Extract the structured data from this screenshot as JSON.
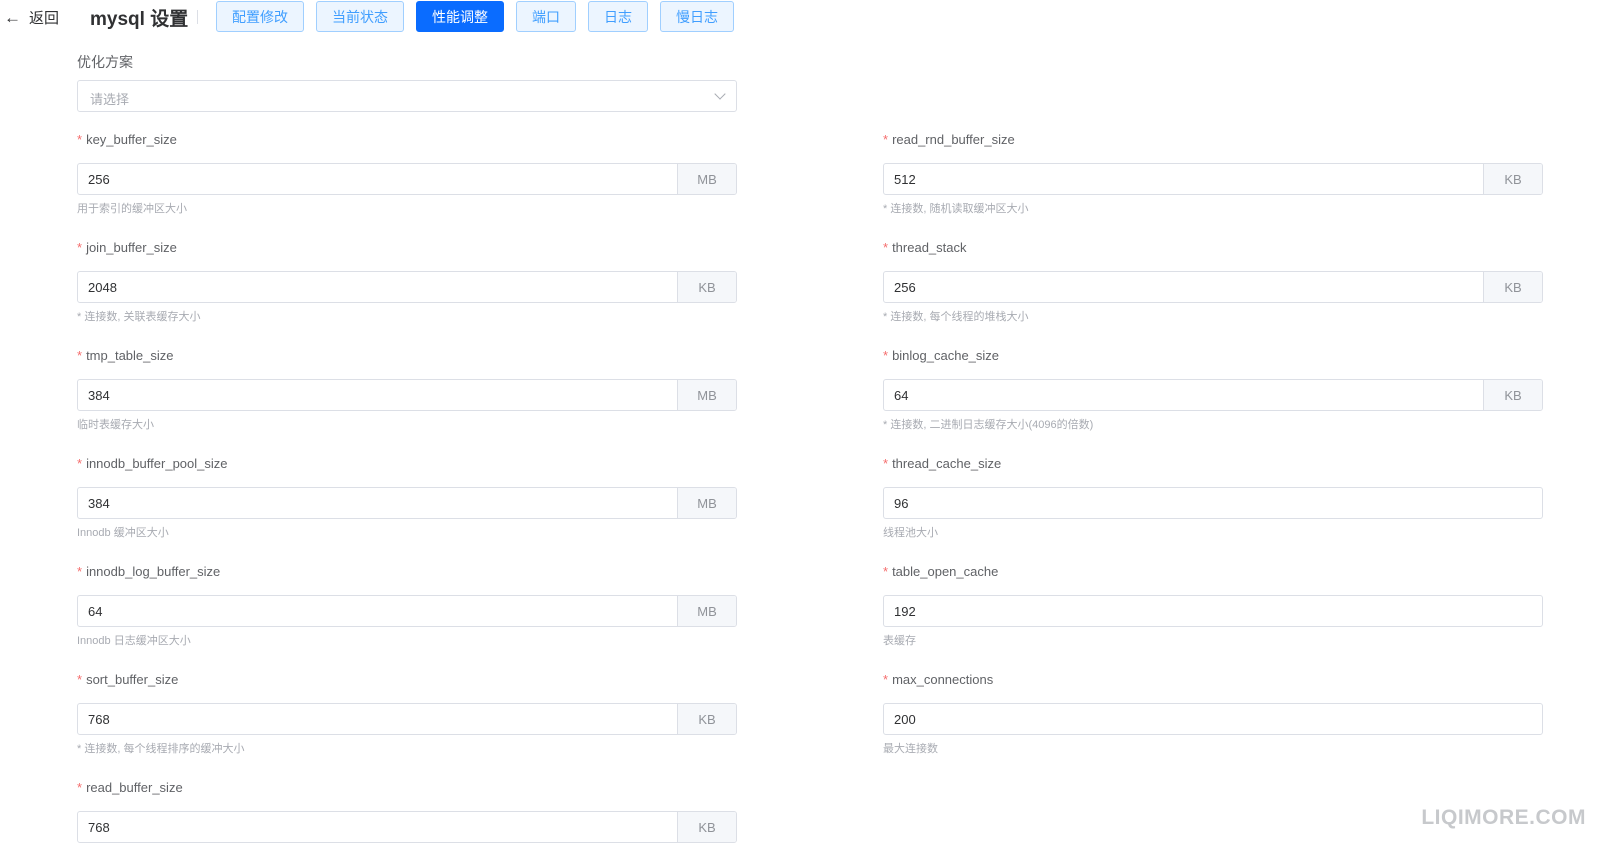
{
  "header": {
    "back_label": "返回",
    "title": "mysql 设置",
    "tabs": [
      {
        "label": "配置修改",
        "active": false
      },
      {
        "label": "当前状态",
        "active": false
      },
      {
        "label": "性能调整",
        "active": true
      },
      {
        "label": "端口",
        "active": false
      },
      {
        "label": "日志",
        "active": false
      },
      {
        "label": "慢日志",
        "active": false
      }
    ]
  },
  "optimization": {
    "label": "优化方案",
    "placeholder": "请选择"
  },
  "fields": {
    "key_buffer_size": {
      "label": "key_buffer_size",
      "value": "256",
      "unit": "MB",
      "hint": "用于索引的缓冲区大小"
    },
    "read_rnd_buffer_size": {
      "label": "read_rnd_buffer_size",
      "value": "512",
      "unit": "KB",
      "hint": "* 连接数, 随机读取缓冲区大小"
    },
    "join_buffer_size": {
      "label": "join_buffer_size",
      "value": "2048",
      "unit": "KB",
      "hint": "* 连接数, 关联表缓存大小"
    },
    "thread_stack": {
      "label": "thread_stack",
      "value": "256",
      "unit": "KB",
      "hint": "* 连接数, 每个线程的堆栈大小"
    },
    "tmp_table_size": {
      "label": "tmp_table_size",
      "value": "384",
      "unit": "MB",
      "hint": "临时表缓存大小"
    },
    "binlog_cache_size": {
      "label": "binlog_cache_size",
      "value": "64",
      "unit": "KB",
      "hint": "* 连接数, 二进制日志缓存大小(4096的倍数)"
    },
    "innodb_buffer_pool_size": {
      "label": "innodb_buffer_pool_size",
      "value": "384",
      "unit": "MB",
      "hint": "Innodb 缓冲区大小"
    },
    "thread_cache_size": {
      "label": "thread_cache_size",
      "value": "96",
      "hint": "线程池大小"
    },
    "innodb_log_buffer_size": {
      "label": "innodb_log_buffer_size",
      "value": "64",
      "unit": "MB",
      "hint": "Innodb 日志缓冲区大小"
    },
    "table_open_cache": {
      "label": "table_open_cache",
      "value": "192",
      "hint": "表缓存"
    },
    "sort_buffer_size": {
      "label": "sort_buffer_size",
      "value": "768",
      "unit": "KB",
      "hint": "* 连接数, 每个线程排序的缓冲大小"
    },
    "max_connections": {
      "label": "max_connections",
      "value": "200",
      "hint": "最大连接数"
    },
    "read_buffer_size": {
      "label": "read_buffer_size",
      "value": "768",
      "unit": "KB"
    }
  },
  "required_mark": "*",
  "watermark": "LIQIMORE.COM"
}
